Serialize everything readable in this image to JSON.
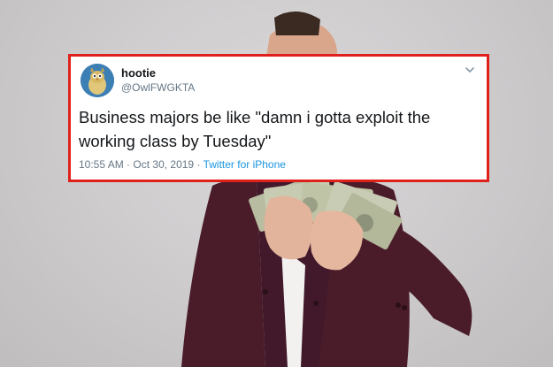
{
  "tweet": {
    "display_name": "hootie",
    "handle": "@OwlFWGKTA",
    "text": "Business majors be like \"damn i gotta exploit the working class by Tuesday\"",
    "time": "10:55 AM",
    "separator": "·",
    "date": "Oct 30, 2019",
    "source": "Twitter for iPhone",
    "avatar_icon": "owl-avatar-icon",
    "menu_icon": "chevron-down-icon"
  },
  "colors": {
    "highlight_border": "#e0201b",
    "link": "#1b95e0",
    "muted": "#657786",
    "text": "#14171a"
  }
}
